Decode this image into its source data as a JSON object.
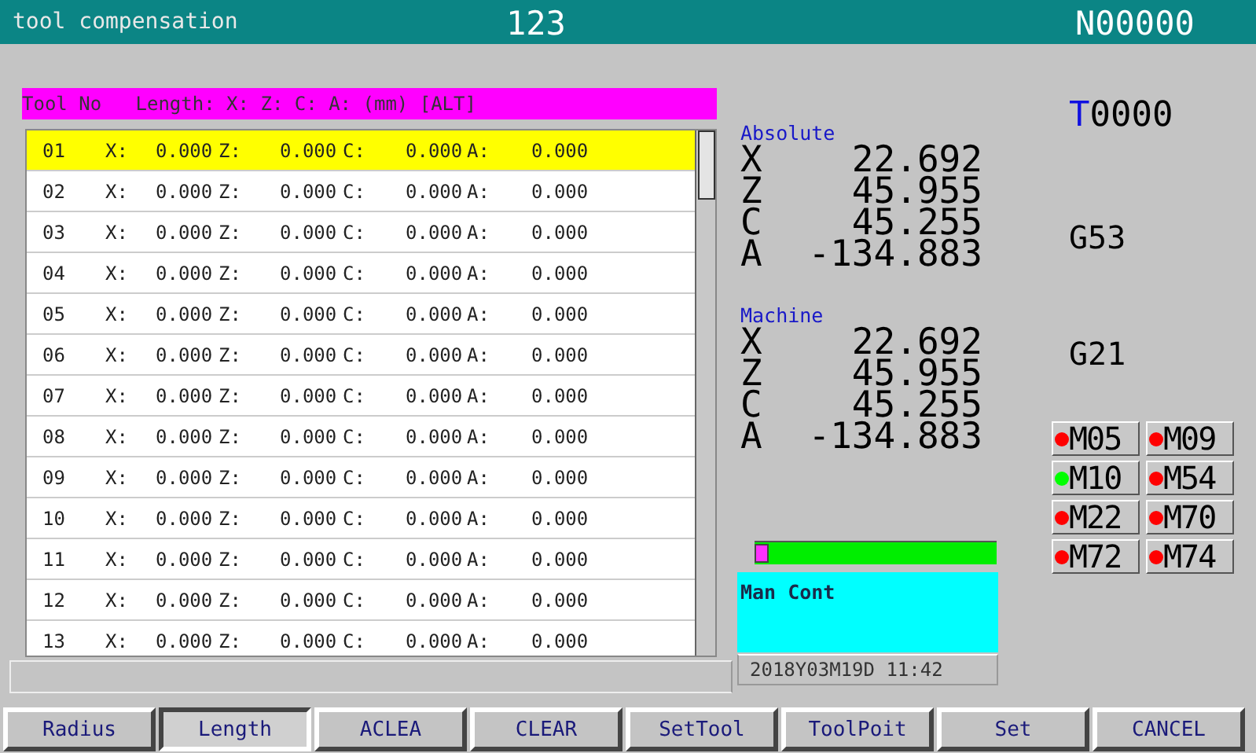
{
  "title_bar": {
    "screen": "tool compensation",
    "program": "123",
    "line": "N00000"
  },
  "table": {
    "header": "Tool No   Length: X: Z: C: A: (mm) [ALT]",
    "rows": [
      {
        "no": "01",
        "selected": true,
        "cells": [
          {
            "label": "X:",
            "value": "0.000"
          },
          {
            "label": "Z:",
            "value": "0.000"
          },
          {
            "label": "C:",
            "value": "0.000"
          },
          {
            "label": "A:",
            "value": "0.000"
          }
        ]
      },
      {
        "no": "02",
        "selected": false,
        "cells": [
          {
            "label": "X:",
            "value": "0.000"
          },
          {
            "label": "Z:",
            "value": "0.000"
          },
          {
            "label": "C:",
            "value": "0.000"
          },
          {
            "label": "A:",
            "value": "0.000"
          }
        ]
      },
      {
        "no": "03",
        "selected": false,
        "cells": [
          {
            "label": "X:",
            "value": "0.000"
          },
          {
            "label": "Z:",
            "value": "0.000"
          },
          {
            "label": "C:",
            "value": "0.000"
          },
          {
            "label": "A:",
            "value": "0.000"
          }
        ]
      },
      {
        "no": "04",
        "selected": false,
        "cells": [
          {
            "label": "X:",
            "value": "0.000"
          },
          {
            "label": "Z:",
            "value": "0.000"
          },
          {
            "label": "C:",
            "value": "0.000"
          },
          {
            "label": "A:",
            "value": "0.000"
          }
        ]
      },
      {
        "no": "05",
        "selected": false,
        "cells": [
          {
            "label": "X:",
            "value": "0.000"
          },
          {
            "label": "Z:",
            "value": "0.000"
          },
          {
            "label": "C:",
            "value": "0.000"
          },
          {
            "label": "A:",
            "value": "0.000"
          }
        ]
      },
      {
        "no": "06",
        "selected": false,
        "cells": [
          {
            "label": "X:",
            "value": "0.000"
          },
          {
            "label": "Z:",
            "value": "0.000"
          },
          {
            "label": "C:",
            "value": "0.000"
          },
          {
            "label": "A:",
            "value": "0.000"
          }
        ]
      },
      {
        "no": "07",
        "selected": false,
        "cells": [
          {
            "label": "X:",
            "value": "0.000"
          },
          {
            "label": "Z:",
            "value": "0.000"
          },
          {
            "label": "C:",
            "value": "0.000"
          },
          {
            "label": "A:",
            "value": "0.000"
          }
        ]
      },
      {
        "no": "08",
        "selected": false,
        "cells": [
          {
            "label": "X:",
            "value": "0.000"
          },
          {
            "label": "Z:",
            "value": "0.000"
          },
          {
            "label": "C:",
            "value": "0.000"
          },
          {
            "label": "A:",
            "value": "0.000"
          }
        ]
      },
      {
        "no": "09",
        "selected": false,
        "cells": [
          {
            "label": "X:",
            "value": "0.000"
          },
          {
            "label": "Z:",
            "value": "0.000"
          },
          {
            "label": "C:",
            "value": "0.000"
          },
          {
            "label": "A:",
            "value": "0.000"
          }
        ]
      },
      {
        "no": "10",
        "selected": false,
        "cells": [
          {
            "label": "X:",
            "value": "0.000"
          },
          {
            "label": "Z:",
            "value": "0.000"
          },
          {
            "label": "C:",
            "value": "0.000"
          },
          {
            "label": "A:",
            "value": "0.000"
          }
        ]
      },
      {
        "no": "11",
        "selected": false,
        "cells": [
          {
            "label": "X:",
            "value": "0.000"
          },
          {
            "label": "Z:",
            "value": "0.000"
          },
          {
            "label": "C:",
            "value": "0.000"
          },
          {
            "label": "A:",
            "value": "0.000"
          }
        ]
      },
      {
        "no": "12",
        "selected": false,
        "cells": [
          {
            "label": "X:",
            "value": "0.000"
          },
          {
            "label": "Z:",
            "value": "0.000"
          },
          {
            "label": "C:",
            "value": "0.000"
          },
          {
            "label": "A:",
            "value": "0.000"
          }
        ]
      },
      {
        "no": "13",
        "selected": false,
        "cells": [
          {
            "label": "X:",
            "value": "0.000"
          },
          {
            "label": "Z:",
            "value": "0.000"
          },
          {
            "label": "C:",
            "value": "0.000"
          },
          {
            "label": "A:",
            "value": "0.000"
          }
        ]
      }
    ]
  },
  "positions": [
    {
      "title": "Absolute",
      "axes": [
        {
          "axis": "X",
          "value": "22.692"
        },
        {
          "axis": "Z",
          "value": "45.955"
        },
        {
          "axis": "C",
          "value": "45.255"
        },
        {
          "axis": "A",
          "value": "-134.883"
        }
      ]
    },
    {
      "title": "Machine",
      "axes": [
        {
          "axis": "X",
          "value": "22.692"
        },
        {
          "axis": "Z",
          "value": "45.955"
        },
        {
          "axis": "C",
          "value": "45.255"
        },
        {
          "axis": "A",
          "value": "-134.883"
        }
      ]
    }
  ],
  "tool": {
    "prefix": "T",
    "number": "0000"
  },
  "modes": [
    "G53",
    "G21"
  ],
  "m_codes": [
    {
      "code": "M05",
      "color": "#ff0000"
    },
    {
      "code": "M09",
      "color": "#ff0000"
    },
    {
      "code": "M10",
      "color": "#00ff00"
    },
    {
      "code": "M54",
      "color": "#ff0000"
    },
    {
      "code": "M22",
      "color": "#ff0000"
    },
    {
      "code": "M70",
      "color": "#ff0000"
    },
    {
      "code": "M72",
      "color": "#ff0000"
    },
    {
      "code": "M74",
      "color": "#ff0000"
    }
  ],
  "progress": {
    "level": 0
  },
  "message": "Man Cont",
  "datetime": "2018Y03M19D 11:42",
  "softkeys": [
    {
      "label": "Radius",
      "selected": false
    },
    {
      "label": "Length",
      "selected": true
    },
    {
      "label": "ACLEA",
      "selected": false
    },
    {
      "label": "CLEAR",
      "selected": false
    },
    {
      "label": "SetTool",
      "selected": false
    },
    {
      "label": "ToolPoit",
      "selected": false
    },
    {
      "label": "Set",
      "selected": false
    },
    {
      "label": "CANCEL",
      "selected": false
    }
  ]
}
